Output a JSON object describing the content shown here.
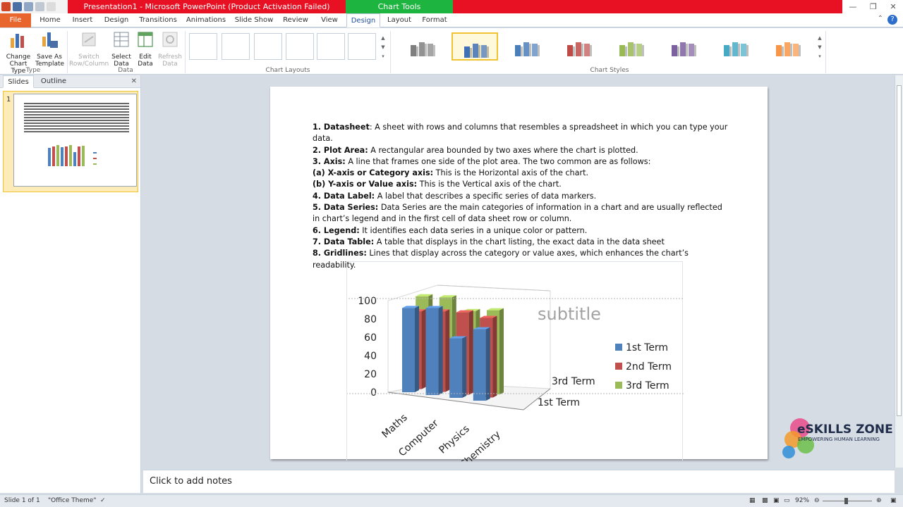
{
  "app": {
    "title": "Presentation1 - Microsoft PowerPoint (Product Activation Failed)",
    "context_tab_group": "Chart Tools"
  },
  "tabs": [
    "File",
    "Home",
    "Insert",
    "Design",
    "Transitions",
    "Animations",
    "Slide Show",
    "Review",
    "View",
    "Design",
    "Layout",
    "Format"
  ],
  "active_tab_index": 9,
  "ribbon": {
    "type_group": {
      "label": "Type",
      "change_chart_type": "Change\nChart Type",
      "save_as_template": "Save As\nTemplate"
    },
    "data_group": {
      "label": "Data",
      "switch_row_column": "Switch\nRow/Column",
      "select_data": "Select\nData",
      "edit_data": "Edit\nData",
      "refresh_data": "Refresh\nData"
    },
    "chart_layouts_label": "Chart Layouts",
    "chart_styles_label": "Chart Styles",
    "style_colors": [
      "#7f7f7f",
      "#3f6fb4",
      "#4a7ebb",
      "#be4b48",
      "#98b954",
      "#7d60a0",
      "#46aac5",
      "#f79646"
    ],
    "selected_style_index": 1
  },
  "left_panel": {
    "tabs": [
      "Slides",
      "Outline"
    ],
    "slide_number": "1"
  },
  "slide": {
    "definitions": [
      {
        "term": "1. Datasheet",
        "text": ": A sheet with rows and columns that resembles a spreadsheet in which you can type your data."
      },
      {
        "term": "2. Plot Area:",
        "text": " A rectangular area bounded by two axes where the chart is plotted."
      },
      {
        "term": "3. Axis:",
        "text": " A line that frames one side of the plot area. The two common are as follows:"
      },
      {
        "term": "(a) X-axis or Category axis:",
        "text": " This is the Horizontal axis of the chart."
      },
      {
        "term": "(b) Y-axis or Value axis:",
        "text": " This is the Vertical axis of the chart."
      },
      {
        "term": "4. Data Label:",
        "text": " A label that describes a specific series of data markers."
      },
      {
        "term": "5. Data Series:",
        "text": " Data Series are the main categories of information in a chart and are usually reflected in chart’s legend and in the first cell of data sheet row or column."
      },
      {
        "term": "6. Legend:",
        "text": " It identifies each data series in a unique color or pattern."
      },
      {
        "term": "7. Data Table:",
        "text": " A table that displays in the chart listing, the exact data in the data sheet"
      },
      {
        "term": "8. Gridlines:",
        "text": " Lines that display across the category or value axes, which enhances the chart’s readability."
      }
    ],
    "chart_placeholder_text": "subtitle"
  },
  "chart_data": {
    "type": "bar",
    "categories": [
      "Maths",
      "Computer",
      "Physics",
      "Chemistry"
    ],
    "depth_labels": [
      "1st Term",
      "3rd Term"
    ],
    "series": [
      {
        "name": "1st Term",
        "values": [
          92,
          95,
          65,
          78
        ],
        "color": "#4f81bd"
      },
      {
        "name": "2nd Term",
        "values": [
          85,
          88,
          90,
          87
        ],
        "color": "#c0504d"
      },
      {
        "name": "3rd Term",
        "values": [
          98,
          100,
          88,
          92
        ],
        "color": "#9bbb59"
      }
    ],
    "y_ticks": [
      "0",
      "20",
      "40",
      "60",
      "80",
      "100"
    ],
    "ylim": [
      0,
      100
    ],
    "legend_position": "right"
  },
  "notes": {
    "placeholder": "Click to add notes"
  },
  "statusbar": {
    "slide_info": "Slide 1 of 1",
    "theme": "\"Office Theme\"",
    "zoom": "92%"
  },
  "watermark": {
    "name": "eSKILLS ZONE",
    "tagline": "EMPOWERING HUMAN LEARNING"
  }
}
